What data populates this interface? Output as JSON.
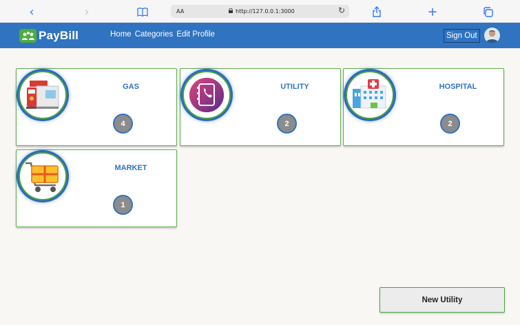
{
  "browser": {
    "text_size_label": "AA",
    "url": "http://127.0.0.1:3000"
  },
  "header": {
    "brand": "PayBill",
    "nav": [
      {
        "label": "Home"
      },
      {
        "label": "Categories"
      },
      {
        "label": "Edit Profile"
      }
    ],
    "sign_out_label": "Sign Out"
  },
  "categories": [
    {
      "title": "GAS",
      "count": "4",
      "icon": "gas-station-icon"
    },
    {
      "title": "UTILITY",
      "count": "2",
      "icon": "phone-book-icon"
    },
    {
      "title": "HOSPITAL",
      "count": "2",
      "icon": "hospital-icon"
    },
    {
      "title": "MARKET",
      "count": "1",
      "icon": "shopping-cart-icon"
    }
  ],
  "actions": {
    "new_utility_label": "New Utility"
  },
  "colors": {
    "header_bg": "#2f73c1",
    "accent_green": "#4cae3c",
    "count_badge": "#8c8c8c"
  }
}
